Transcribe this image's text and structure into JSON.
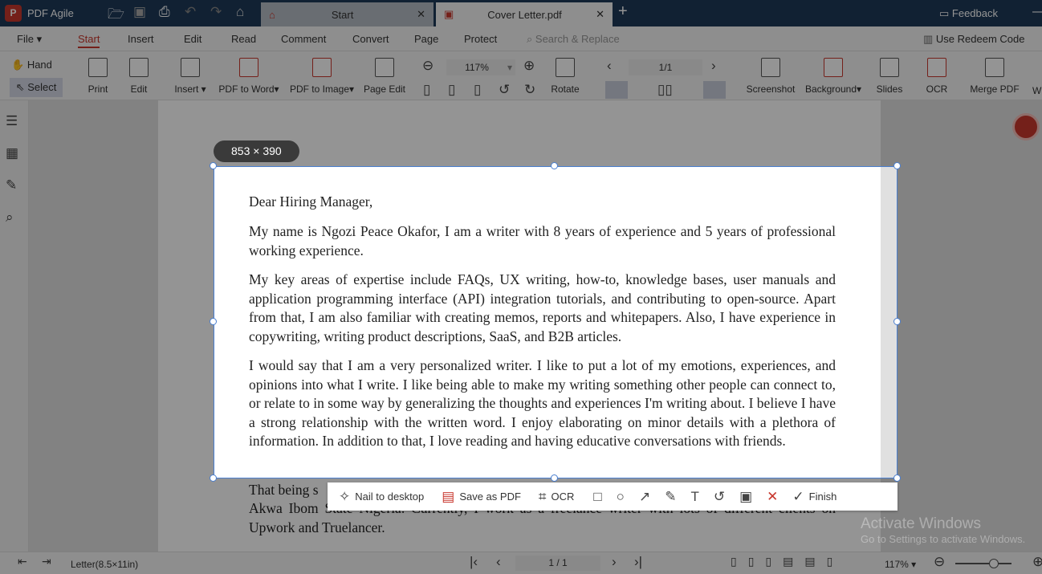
{
  "app": {
    "title": "PDF Agile",
    "feedback": "Feedback"
  },
  "tabs": [
    {
      "label": "Start"
    },
    {
      "label": "Cover Letter.pdf"
    }
  ],
  "menu": [
    "File",
    "Start",
    "Insert",
    "Edit",
    "Read",
    "Comment",
    "Convert",
    "Page",
    "Protect"
  ],
  "search": {
    "placeholder": "Search & Replace"
  },
  "redeem": "Use Redeem Code",
  "ribbon": {
    "hand": "Hand",
    "select": "Select",
    "print": "Print",
    "edit": "Edit",
    "insert": "Insert",
    "pdf_to_word": "PDF to Word",
    "pdf_to_image": "PDF to Image",
    "page_edit": "Page Edit",
    "zoom": "117%",
    "rotate": "Rotate",
    "page": "1/1",
    "screenshot": "Screenshot",
    "background": "Background",
    "slides": "Slides",
    "ocr": "OCR",
    "merge": "Merge PDF",
    "more": "W"
  },
  "selection": {
    "size": "853 × 390"
  },
  "document": {
    "paragraphs": [
      "Dear Hiring Manager,",
      "My name is Ngozi Peace Okafor, I am a writer with 8 years of experience and 5 years of professional working experience.",
      "My key areas of expertise include FAQs, UX writing, how-to, knowledge bases, user manuals and application programming interface (API) integration tutorials, and contributing to open-source. Apart from that, I am also familiar with creating memos, reports and whitepapers. Also, I have experience in copywriting, writing product descriptions, SaaS, and B2B articles.",
      "I would say that I am a very personalized writer. I like to put a lot of my emotions, experiences, and opinions into what I write. I like being able to make my writing something other people can connect to, or relate to in some way by generalizing the thoughts and experiences I'm writing about. I believe I have a strong relationship with the written word. I enjoy elaborating on minor details with a plethora of information. In addition to that, I love reading and having educative conversations with friends.",
      "That being s",
      "Akwa Ibom State Nigeria. Currently, I work as a freelance writer with lots of different clients on Upwork and Truelancer."
    ]
  },
  "snapbar": {
    "nail": "Nail to desktop",
    "save_pdf": "Save as PDF",
    "ocr": "OCR",
    "finish": "Finish"
  },
  "status": {
    "paper": "Letter(8.5×11in)",
    "page": "1 / 1",
    "zoom": "117%"
  },
  "watermark": {
    "line1": "Activate Windows",
    "line2": "Go to Settings to activate Windows."
  },
  "colors": {
    "accent": "#c8372d",
    "titlebar": "#1e3a58",
    "selection": "#4a7fd0"
  }
}
